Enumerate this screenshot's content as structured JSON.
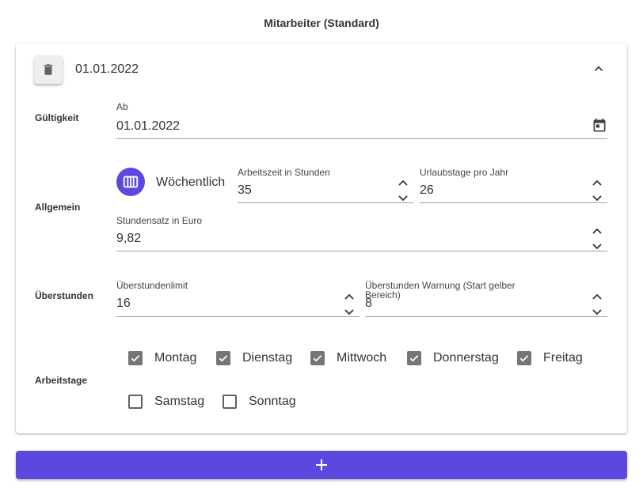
{
  "page": {
    "title": "Mitarbeiter (Standard)"
  },
  "card": {
    "header_date": "01.01.2022",
    "icons": {
      "delete": "trash-icon",
      "collapse": "chevron-up-icon"
    },
    "gueltigkeit": {
      "label": "Gültigkeit",
      "ab": {
        "label": "Ab",
        "value": "01.01.2022",
        "icon": "calendar-icon"
      }
    },
    "allgemein": {
      "label": "Allgemein",
      "interval_label": "Wöchentlich",
      "interval_icon": "calendar-view-week-icon",
      "arbeitszeit": {
        "label": "Arbeitszeit in Stunden",
        "value": "35"
      },
      "urlaubstage": {
        "label": "Urlaubstage pro Jahr",
        "value": "26"
      },
      "stundensatz": {
        "label": "Stundensatz in Euro",
        "value": "9,82"
      }
    },
    "ueberstunden": {
      "label": "Überstunden",
      "limit": {
        "label": "Überstundenlimit",
        "value": "16"
      },
      "warnung": {
        "label": "Überstunden Warnung (Start gelber Bereich)",
        "value": "8"
      }
    },
    "arbeitstage": {
      "label": "Arbeitstage",
      "days": [
        {
          "label": "Montag",
          "checked": true
        },
        {
          "label": "Dienstag",
          "checked": true
        },
        {
          "label": "Mittwoch",
          "checked": true
        },
        {
          "label": "Donnerstag",
          "checked": true
        },
        {
          "label": "Freitag",
          "checked": true
        },
        {
          "label": "Samstag",
          "checked": false
        },
        {
          "label": "Sonntag",
          "checked": false
        }
      ]
    }
  },
  "add_button": {
    "icon": "plus-icon"
  },
  "colors": {
    "accent": "#5b48df",
    "checkbox_checked": "#757575",
    "underline": "#9e9e9e"
  }
}
